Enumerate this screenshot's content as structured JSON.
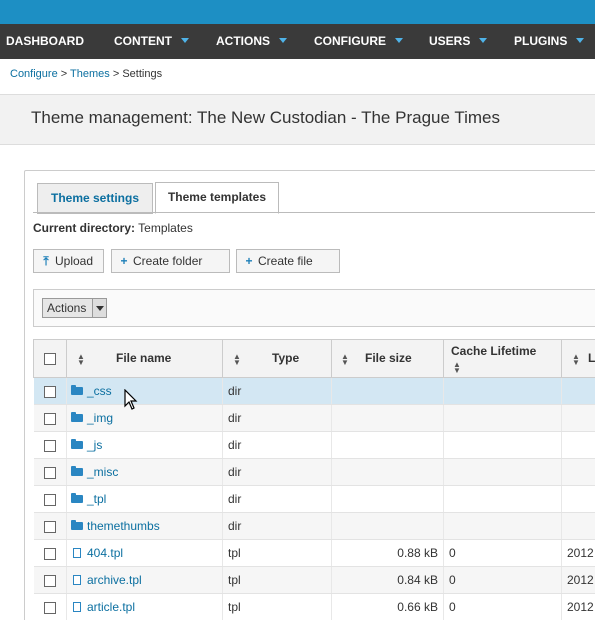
{
  "nav": {
    "items": [
      {
        "label": "DASHBOARD"
      },
      {
        "label": "CONTENT"
      },
      {
        "label": "ACTIONS"
      },
      {
        "label": "CONFIGURE"
      },
      {
        "label": "USERS"
      },
      {
        "label": "PLUGINS"
      }
    ]
  },
  "breadcrumb": {
    "configure": "Configure",
    "sep1": " > ",
    "themes": "Themes",
    "sep2": " > ",
    "current": "Settings"
  },
  "page": {
    "title": "Theme management: The New Custodian - The Prague Times"
  },
  "tabs": [
    {
      "label": "Theme settings"
    },
    {
      "label": "Theme templates"
    }
  ],
  "current_directory": {
    "label": "Current directory:",
    "value": "Templates"
  },
  "buttons": {
    "upload": "Upload",
    "create_folder": "Create folder",
    "create_file": "Create file"
  },
  "actions_select": {
    "selected": "Actions"
  },
  "table": {
    "headers": {
      "file_name": "File name",
      "type": "Type",
      "file_size": "File size",
      "cache_lifetime": "Cache Lifetime",
      "last": "La"
    },
    "rows": [
      {
        "name": "_css",
        "kind": "folder",
        "type": "dir",
        "size": "",
        "cache": "",
        "last": ""
      },
      {
        "name": "_img",
        "kind": "folder",
        "type": "dir",
        "size": "",
        "cache": "",
        "last": ""
      },
      {
        "name": "_js",
        "kind": "folder",
        "type": "dir",
        "size": "",
        "cache": "",
        "last": ""
      },
      {
        "name": "_misc",
        "kind": "folder",
        "type": "dir",
        "size": "",
        "cache": "",
        "last": ""
      },
      {
        "name": "_tpl",
        "kind": "folder",
        "type": "dir",
        "size": "",
        "cache": "",
        "last": ""
      },
      {
        "name": "themethumbs",
        "kind": "folder",
        "type": "dir",
        "size": "",
        "cache": "",
        "last": ""
      },
      {
        "name": "404.tpl",
        "kind": "file",
        "type": "tpl",
        "size": "0.88 kB",
        "cache": "0",
        "last": "2012"
      },
      {
        "name": "archive.tpl",
        "kind": "file",
        "type": "tpl",
        "size": "0.84 kB",
        "cache": "0",
        "last": "2012"
      },
      {
        "name": "article.tpl",
        "kind": "file",
        "type": "tpl",
        "size": "0.66 kB",
        "cache": "0",
        "last": "2012"
      }
    ]
  },
  "colors": {
    "top_stripe": "#1d8fc4",
    "nav_bg": "#3a3a3a",
    "link": "#0b6fa0",
    "selected_row": "#d3e7f3"
  }
}
